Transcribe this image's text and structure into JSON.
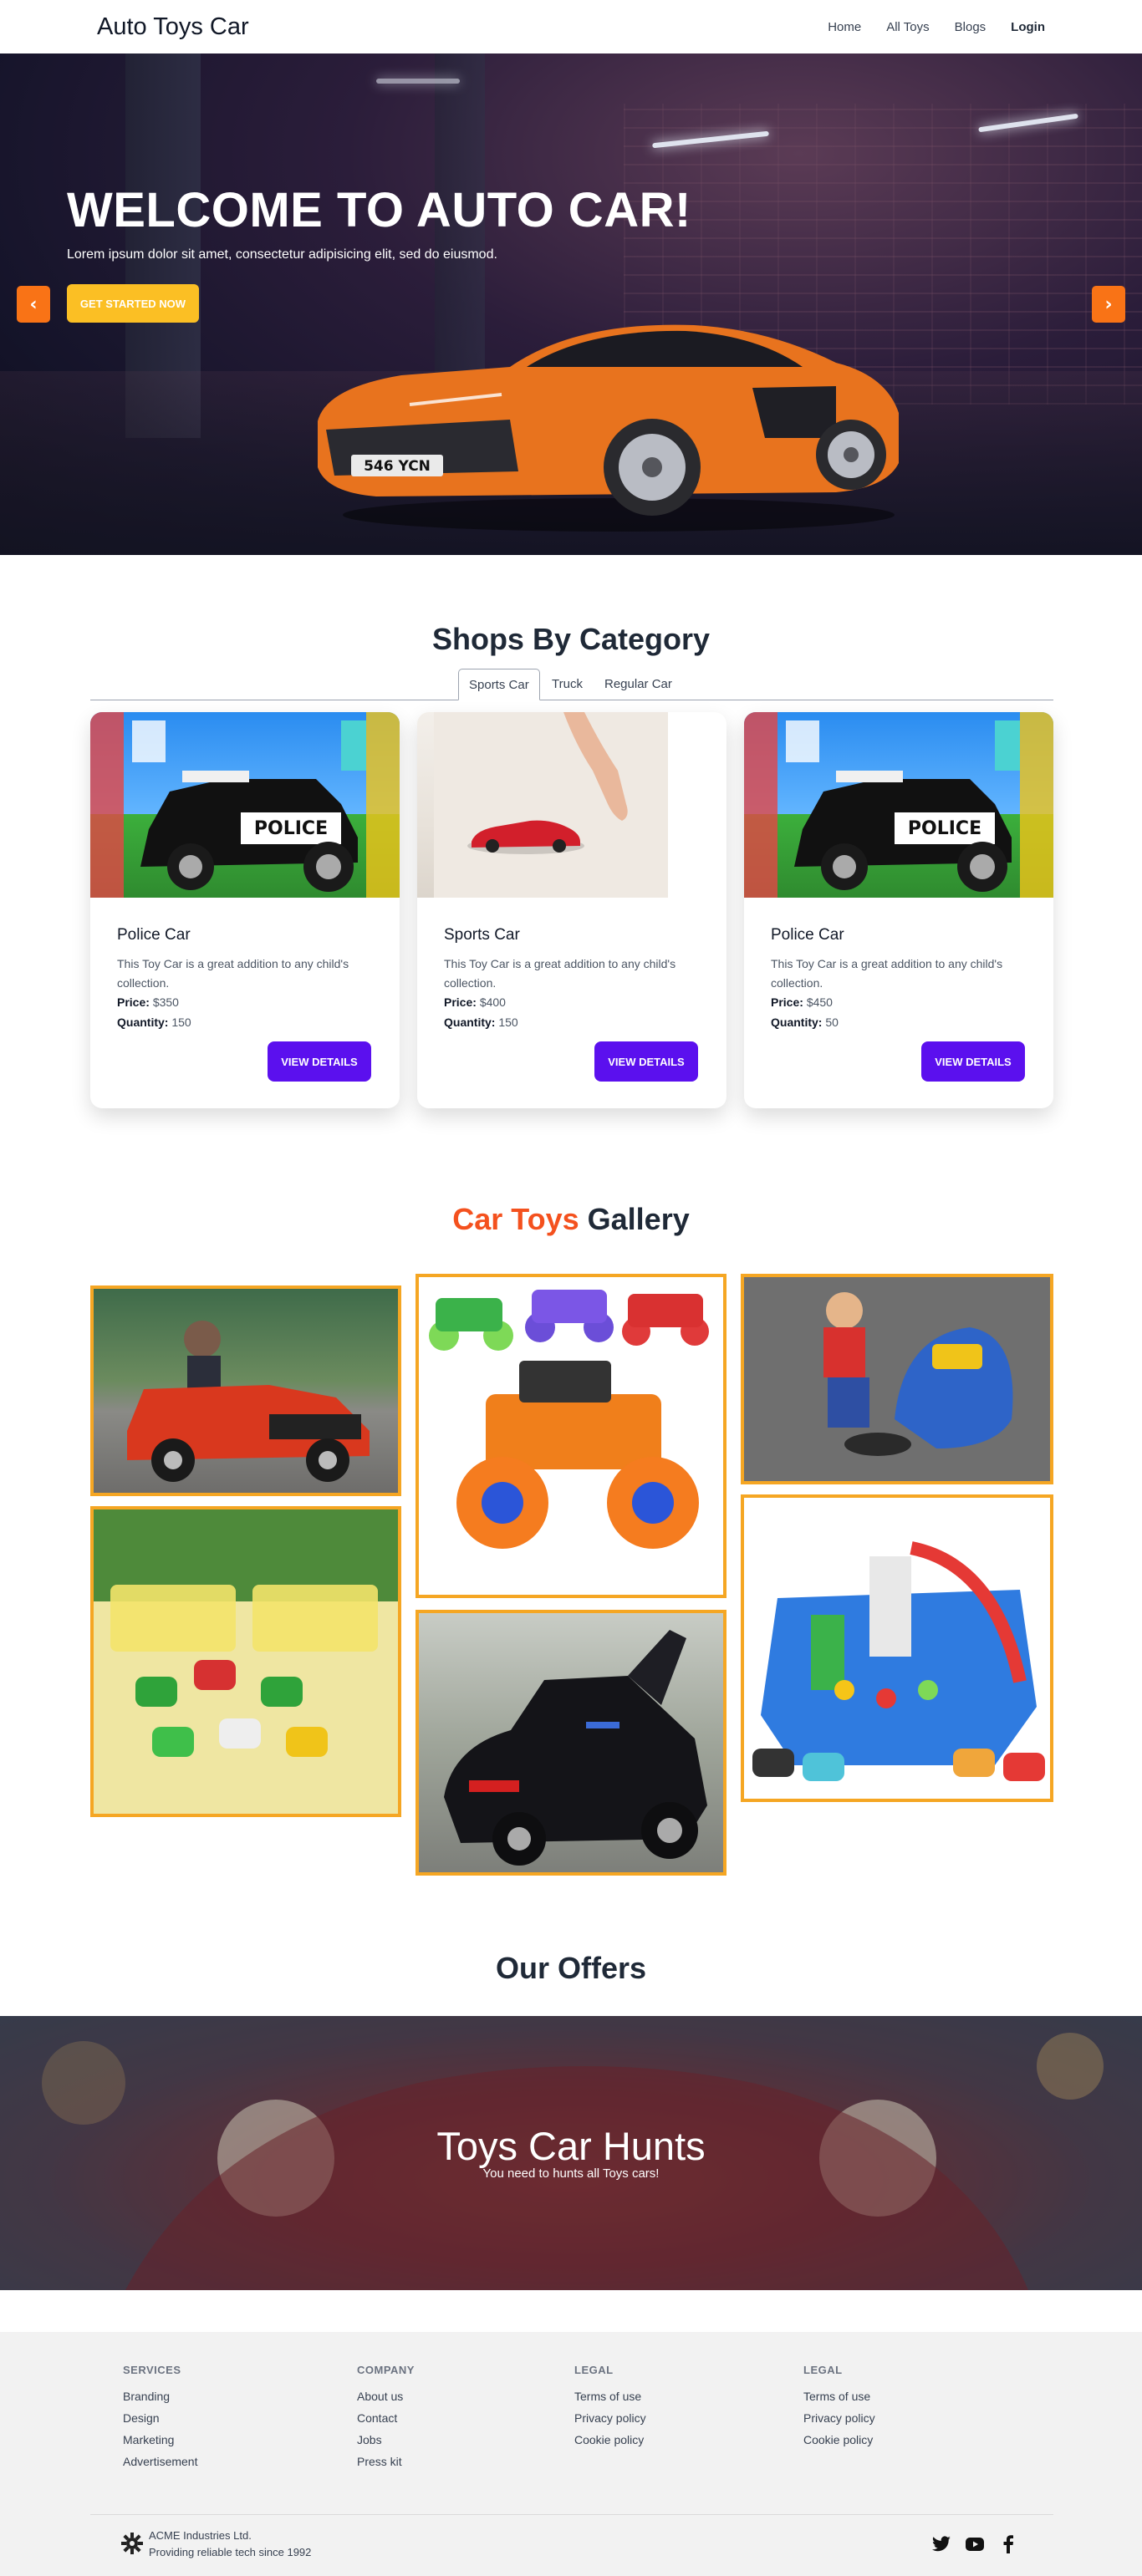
{
  "navbar": {
    "brand": "Auto Toys Car",
    "links": [
      "Home",
      "All Toys",
      "Blogs"
    ],
    "login": "Login"
  },
  "hero": {
    "title": "WELCOME TO AUTO CAR!",
    "subtitle": "Lorem ipsum dolor sit amet, consectetur adipisicing elit, sed do eiusmod.",
    "cta": "GET STARTED NOW",
    "plate": "546 YCN",
    "prev": "‹",
    "next": "›"
  },
  "category": {
    "title": "Shops By Category",
    "tabs": [
      "Sports Car",
      "Truck",
      "Regular Car"
    ],
    "active_tab": "Sports Car",
    "cards": [
      {
        "title": "Police Car",
        "desc": "This Toy Car is a great addition to any child's collection.",
        "price_label": "Price:",
        "price": "$350",
        "qty_label": "Quantity:",
        "qty": "150",
        "button": "VIEW DETAILS"
      },
      {
        "title": "Sports Car",
        "desc": "This Toy Car is a great addition to any child's collection.",
        "price_label": "Price:",
        "price": "$400",
        "qty_label": "Quantity:",
        "qty": "150",
        "button": "VIEW DETAILS"
      },
      {
        "title": "Police Car",
        "desc": "This Toy Car is a great addition to any child's collection.",
        "price_label": "Price:",
        "price": "$450",
        "qty_label": "Quantity:",
        "qty": "50",
        "button": "VIEW DETAILS"
      }
    ]
  },
  "gallery": {
    "title_accent": "Car Toys",
    "title_rest": "Gallery"
  },
  "offers": {
    "title": "Our Offers",
    "banner_title": "Toys Car Hunts",
    "banner_sub": "You need to hunts all Toys cars!"
  },
  "footer": {
    "columns": [
      {
        "heading": "SERVICES",
        "links": [
          "Branding",
          "Design",
          "Marketing",
          "Advertisement"
        ]
      },
      {
        "heading": "COMPANY",
        "links": [
          "About us",
          "Contact",
          "Jobs",
          "Press kit"
        ]
      },
      {
        "heading": "LEGAL",
        "links": [
          "Terms of use",
          "Privacy policy",
          "Cookie policy"
        ]
      },
      {
        "heading": "LEGAL",
        "links": [
          "Terms of use",
          "Privacy policy",
          "Cookie policy"
        ]
      }
    ],
    "company_name": "ACME Industries Ltd.",
    "company_tagline": "Providing reliable tech since 1992",
    "social_icons": [
      "twitter-icon",
      "youtube-icon",
      "facebook-icon"
    ]
  },
  "colors": {
    "accent_orange": "#f4511e",
    "button_purple": "#5b10ee",
    "cta_yellow": "#fbbf24",
    "gallery_border": "#f5a623"
  }
}
